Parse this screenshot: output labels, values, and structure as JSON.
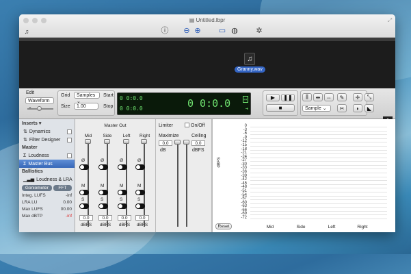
{
  "window": {
    "title": "Untitled.lbpr"
  },
  "toolbar": {
    "info_icon": "info-icon",
    "zoom_out": "zoom-out-icon",
    "zoom_in": "zoom-in-icon",
    "layout": "layout-icon",
    "globe": "globe-icon",
    "settings": "gear-icon"
  },
  "canvas": {
    "file_name": "Granny.wav"
  },
  "edit": {
    "label": "Edit",
    "mode": "Waveform"
  },
  "grid": {
    "label": "Grid",
    "mode": "Samples",
    "size_label": "Size",
    "size_value": "1.00",
    "start_label": "Start",
    "stop_label": "Stop"
  },
  "lcd": {
    "start": "0 0:0.0",
    "stop": "0 0:0.0",
    "main": "0 0:0.0"
  },
  "right_controls": {
    "unit": "Sample"
  },
  "sidebar": {
    "inserts_label": "Inserts",
    "inserts": [
      {
        "label": "Dynamics"
      },
      {
        "label": "Filter Designer"
      }
    ],
    "master_label": "Master",
    "master": [
      {
        "label": "Loudness"
      },
      {
        "label": "Master Bus"
      }
    ],
    "ballistics_label": "Ballistics",
    "ballistics_item": "Loudness & LRA",
    "tabs": {
      "goniometer": "Goniometer",
      "fft": "FFT"
    },
    "stats": [
      {
        "label": "Integ. LUFS",
        "value": "-inf"
      },
      {
        "label": "LRA LU",
        "value": "0.00"
      },
      {
        "label": "Max LUFS",
        "value": "00.00"
      },
      {
        "label": "Max dBTP",
        "value": "-inf"
      }
    ]
  },
  "master_out": {
    "title": "Master Out",
    "channels": [
      {
        "name": "Mid",
        "value": "0.0",
        "unit": "dBFS"
      },
      {
        "name": "Side",
        "value": "0.0",
        "unit": "dBFS"
      },
      {
        "name": "Left",
        "value": "0.0",
        "unit": "dBFS"
      },
      {
        "name": "Right",
        "value": "0.0",
        "unit": "dBFS"
      }
    ],
    "phase_label": "Ø",
    "mute_label": "M",
    "solo_label": "S"
  },
  "limiter": {
    "title": "Limiter",
    "onoff": "On/Off",
    "maximize_label": "Maximize",
    "maximize_value": "0.0",
    "maximize_unit": "dB",
    "ceiling_label": "Ceiling",
    "ceiling_value": "0.0",
    "ceiling_unit": "dBFS"
  },
  "meter": {
    "unit": "dBFS",
    "scale": [
      "0",
      "-3",
      "-6",
      "-9",
      "-12",
      "-15",
      "-18",
      "-21",
      "-24",
      "-27",
      "-30",
      "-33",
      "-36",
      "-39",
      "-42",
      "-45",
      "-48",
      "-51",
      "-54",
      "-57",
      "-60",
      "-63",
      "-66",
      "-69",
      "-72"
    ],
    "labels": [
      "Mid",
      "Side",
      "Left",
      "Right"
    ],
    "reset": "Reset"
  }
}
